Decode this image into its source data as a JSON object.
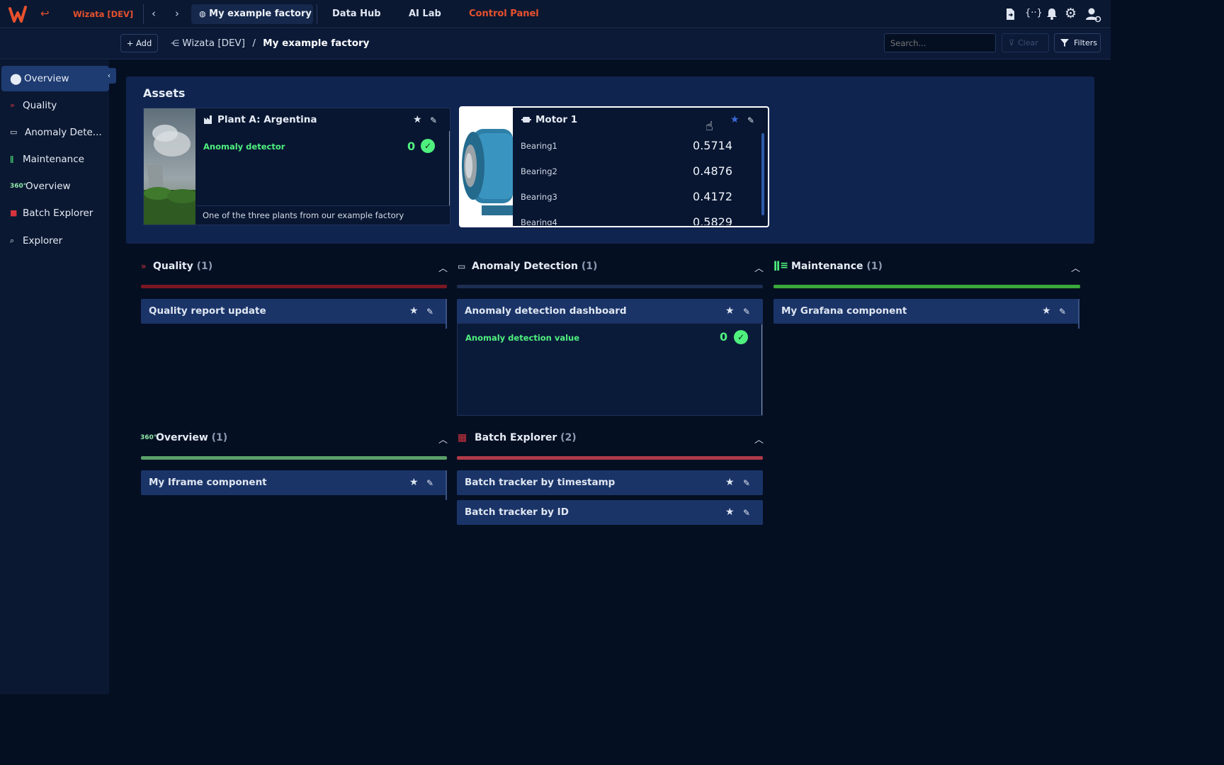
{
  "topbar": {
    "workspace": "Wizata [DEV]",
    "active_tab": "My example factory",
    "nav": [
      "Data Hub",
      "AI Lab",
      "Control Panel"
    ],
    "icons": [
      "logo-icon",
      "back-arrow-icon",
      "chevron-left-icon",
      "chevron-right-icon",
      "globe-icon",
      "file-export-icon",
      "code-braces-icon",
      "bell-icon",
      "gear-icon",
      "user-sync-icon"
    ]
  },
  "subbar": {
    "add_label": "Add",
    "breadcrumb_root": "Wizata [DEV]",
    "breadcrumb_sep": "/",
    "breadcrumb_current": "My example factory",
    "search_placeholder": "Search...",
    "clear_label": "Clear",
    "filters_label": "Filters"
  },
  "sidebar": {
    "items": [
      {
        "label": "Overview",
        "icon": "map-pin-icon",
        "active": true
      },
      {
        "label": "Quality",
        "icon": "chevrons-down-icon"
      },
      {
        "label": "Anomaly Dete...",
        "icon": "monitor-icon"
      },
      {
        "label": "Maintenance",
        "icon": "thermometer-icon"
      },
      {
        "label": "Overview",
        "icon": "360-icon"
      },
      {
        "label": "Batch Explorer",
        "icon": "batch-icon"
      },
      {
        "label": "Explorer",
        "icon": "search-graph-icon"
      }
    ]
  },
  "assets": {
    "title": "Assets",
    "plant": {
      "name": "Plant A: Argentina",
      "metric_label": "Anomaly detector",
      "metric_value": "0",
      "description": "One of the three plants from our example factory"
    },
    "motor": {
      "name": "Motor 1",
      "bearings": [
        {
          "label": "Bearing1",
          "value": "0.5714"
        },
        {
          "label": "Bearing2",
          "value": "0.4876"
        },
        {
          "label": "Bearing3",
          "value": "0.4172"
        },
        {
          "label": "Bearing4",
          "value": "0.5829"
        }
      ]
    }
  },
  "sections": {
    "quality": {
      "title": "Quality",
      "count": "(1)",
      "color": "#7a1822",
      "items": [
        "Quality report update"
      ]
    },
    "anomaly": {
      "title": "Anomaly Detection",
      "count": "(1)",
      "color": "#1d2e52",
      "items": [
        "Anomaly detection dashboard"
      ],
      "metric_label": "Anomaly detection value",
      "metric_value": "0"
    },
    "maintenance": {
      "title": "Maintenance",
      "count": "(1)",
      "color": "#3aa83a",
      "items": [
        "My Grafana component"
      ]
    },
    "overview": {
      "title": "Overview",
      "count": "(1)",
      "color": "#5aa06a",
      "items": [
        "My Iframe component"
      ]
    },
    "batch": {
      "title": "Batch Explorer",
      "count": "(2)",
      "color": "#b03a48",
      "items": [
        "Batch tracker by timestamp",
        "Batch tracker by ID"
      ]
    }
  }
}
